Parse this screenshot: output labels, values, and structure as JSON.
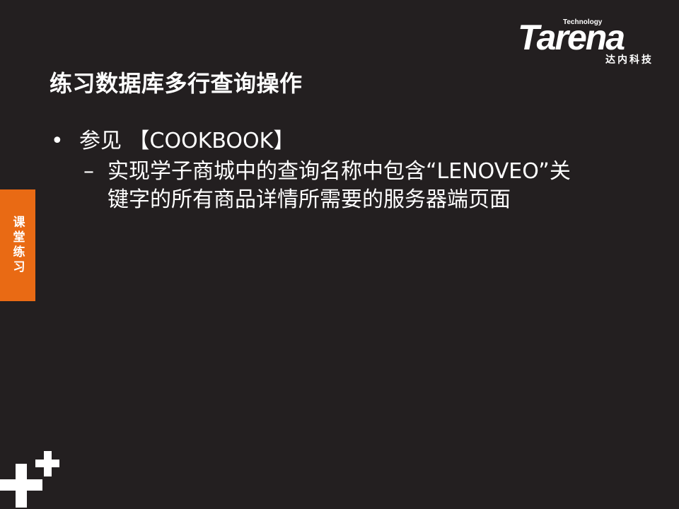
{
  "logo": {
    "brand": "Tarena",
    "tagline": "Technology",
    "cn": "达内科技"
  },
  "slide": {
    "title": "练习数据库多行查询操作",
    "bullet": "参见 【COOKBOOK】",
    "sub_line1": "实现学子商城中的查询名称中包含“LENOVEO”关",
    "sub_line2": "键字的所有商品详情所需要的服务器端页面"
  },
  "side_tab": {
    "label": "课堂练习"
  },
  "colors": {
    "background": "#231f20",
    "accent": "#e96a14",
    "text": "#ffffff"
  }
}
